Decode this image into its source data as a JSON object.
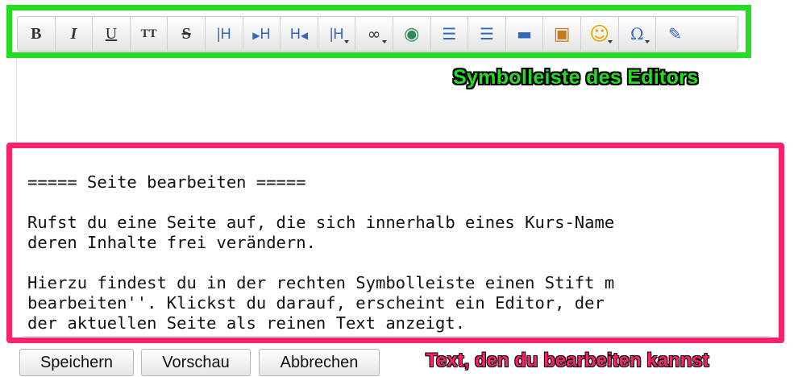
{
  "annotations": {
    "toolbar_label": "Symbolleiste des Editors",
    "text_label": "Text, den du bearbeiten kannst",
    "toolbar_color": "#22dd22",
    "text_color": "#ff2266"
  },
  "toolbar": {
    "buttons": [
      {
        "name": "bold-button",
        "glyph": "B",
        "icon": "bold-icon"
      },
      {
        "name": "italic-button",
        "glyph": "I",
        "icon": "italic-icon"
      },
      {
        "name": "underline-button",
        "glyph": "U",
        "icon": "underline-icon"
      },
      {
        "name": "monospace-button",
        "glyph": "TT",
        "icon": "monospace-icon"
      },
      {
        "name": "strikethrough-button",
        "glyph": "S",
        "icon": "strikethrough-icon"
      },
      {
        "name": "heading-same-button",
        "glyph": "H",
        "icon": "heading-same-icon"
      },
      {
        "name": "heading-lower-button",
        "glyph": "H",
        "icon": "heading-lower-icon"
      },
      {
        "name": "heading-higher-button",
        "glyph": "H",
        "icon": "heading-higher-icon"
      },
      {
        "name": "heading-select-button",
        "glyph": "H",
        "icon": "heading-select-icon"
      },
      {
        "name": "link-button",
        "glyph": "∞",
        "icon": "link-icon"
      },
      {
        "name": "external-link-button",
        "glyph": "◉",
        "icon": "globe-link-icon"
      },
      {
        "name": "ordered-list-button",
        "glyph": "☰",
        "icon": "ordered-list-icon"
      },
      {
        "name": "unordered-list-button",
        "glyph": "☰",
        "icon": "unordered-list-icon"
      },
      {
        "name": "horizontal-rule-button",
        "glyph": "▬",
        "icon": "horizontal-rule-icon"
      },
      {
        "name": "media-button",
        "glyph": "▣",
        "icon": "image-icon"
      },
      {
        "name": "smiley-button",
        "glyph": "☺",
        "icon": "smiley-icon"
      },
      {
        "name": "special-chars-button",
        "glyph": "Ω",
        "icon": "omega-icon"
      },
      {
        "name": "signature-button",
        "glyph": "✎",
        "icon": "signature-icon"
      }
    ]
  },
  "editor": {
    "text": "===== Seite bearbeiten =====\n\nRufst du eine Seite auf, die sich innerhalb eines Kurs-Name\nderen Inhalte frei verändern.\n\nHierzu findest du in der rechten Symbolleiste einen Stift m\nbearbeiten''. Klickst du darauf, erscheint ein Editor, der\nder aktuellen Seite als reinen Text anzeigt."
  },
  "buttons": {
    "save": "Speichern",
    "preview": "Vorschau",
    "cancel": "Abbrechen"
  }
}
